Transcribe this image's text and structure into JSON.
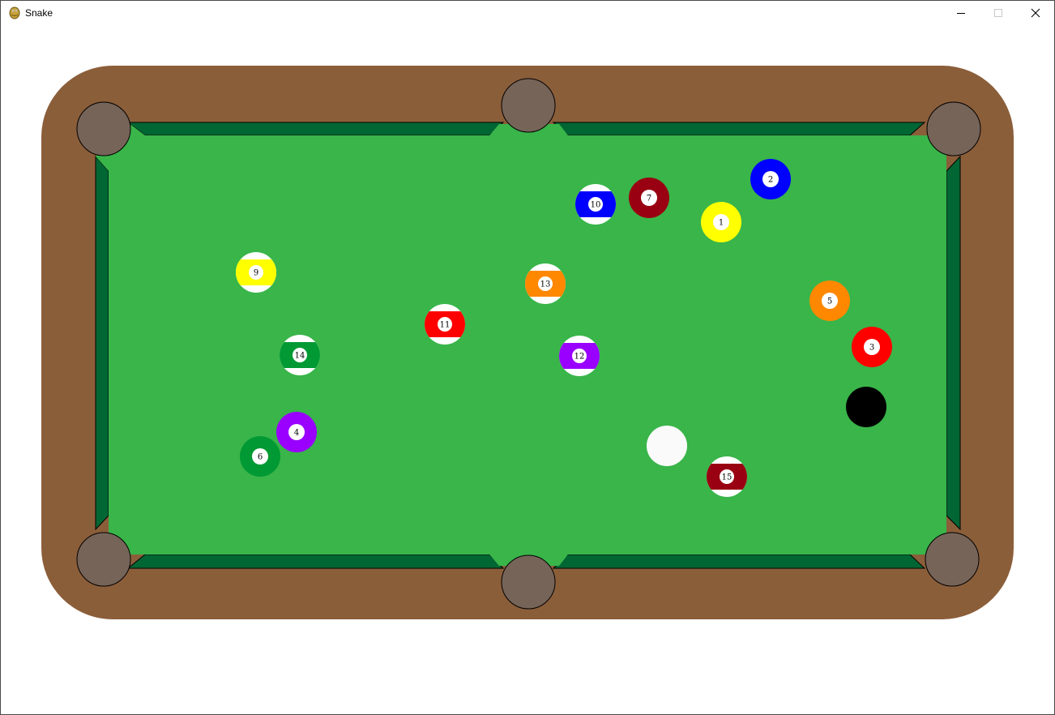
{
  "window": {
    "title": "Snake",
    "app_icon": "python-snake-icon",
    "controls": [
      "minimize",
      "maximize",
      "close"
    ]
  },
  "colors": {
    "rail": "#8B5E3A",
    "felt": "#39B54A",
    "cushion": "#006633",
    "pocket": "#766459",
    "cue_ball": "#FAFAFA",
    "eight_ball": "#000000"
  },
  "balls": {
    "one": {
      "number": "1",
      "color": "#FFFF00",
      "pattern": "solid"
    },
    "two": {
      "number": "2",
      "color": "#0000FF",
      "pattern": "solid"
    },
    "three": {
      "number": "3",
      "color": "#FF0000",
      "pattern": "solid"
    },
    "four": {
      "number": "4",
      "color": "#9900FF",
      "pattern": "solid"
    },
    "five": {
      "number": "5",
      "color": "#FF8800",
      "pattern": "solid"
    },
    "six": {
      "number": "6",
      "color": "#009933",
      "pattern": "solid"
    },
    "seven": {
      "number": "7",
      "color": "#990011",
      "pattern": "solid"
    },
    "nine": {
      "number": "9",
      "color": "#FFFF00",
      "pattern": "stripe"
    },
    "ten": {
      "number": "10",
      "color": "#0000FF",
      "pattern": "stripe"
    },
    "eleven": {
      "number": "11",
      "color": "#FF0000",
      "pattern": "stripe"
    },
    "twelve": {
      "number": "12",
      "color": "#9900FF",
      "pattern": "stripe"
    },
    "thirteen": {
      "number": "13",
      "color": "#FF8800",
      "pattern": "stripe"
    },
    "fourteen": {
      "number": "14",
      "color": "#009933",
      "pattern": "stripe"
    },
    "fifteen": {
      "number": "15",
      "color": "#990011",
      "pattern": "stripe"
    }
  }
}
